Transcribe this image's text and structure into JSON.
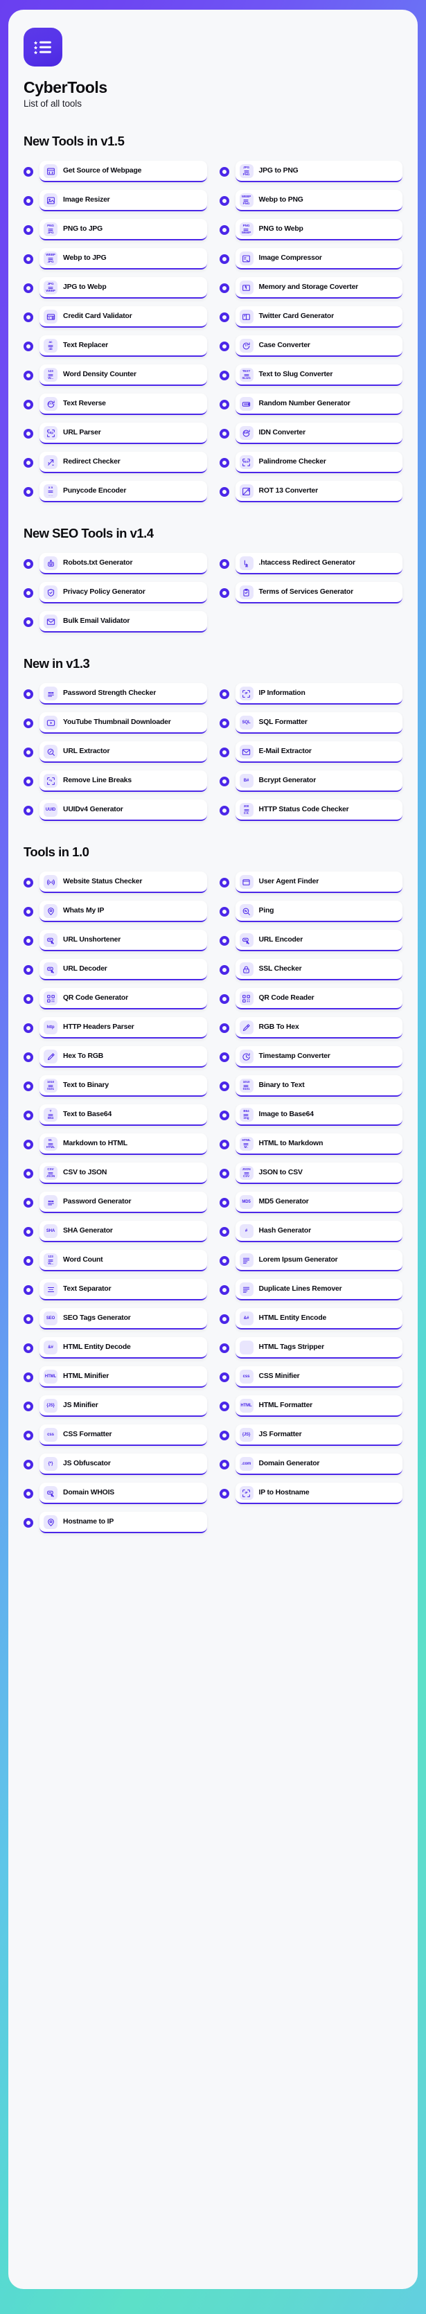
{
  "header": {
    "logo_icon": "bullet-list-star-icon",
    "title": "CyberTools",
    "subtitle": "List of all tools"
  },
  "theme": {
    "accent": "#4b27e8",
    "icon_bg": "#e9e6fd",
    "card_bg": "#ffffff",
    "shell_bg": "#f7f8fa",
    "gradient_from": "#6a3ff0",
    "gradient_to": "#5cd9d6"
  },
  "sections": [
    {
      "title": "New Tools in v1.5",
      "tools": [
        {
          "label": "Get Source of Webpage",
          "icon": "browser-code-icon",
          "glyph": "code"
        },
        {
          "label": "JPG to PNG",
          "icon": "jpg-to-png-icon",
          "glyph": "t2",
          "top": "JPG",
          "bottom": "PNG"
        },
        {
          "label": "Image Resizer",
          "icon": "image-resize-icon",
          "glyph": "image"
        },
        {
          "label": "Webp to PNG",
          "icon": "webp-to-png-icon",
          "glyph": "t2",
          "top": "WEBP",
          "bottom": "PNG"
        },
        {
          "label": "PNG to JPG",
          "icon": "png-to-jpg-icon",
          "glyph": "t2",
          "top": "PNG",
          "bottom": "JPG"
        },
        {
          "label": "PNG to Webp",
          "icon": "png-to-webp-icon",
          "glyph": "t2",
          "top": "PNG",
          "bottom": "WEBP"
        },
        {
          "label": "Webp to JPG",
          "icon": "webp-to-jpg-icon",
          "glyph": "t2",
          "top": "WEBP",
          "bottom": "JPG"
        },
        {
          "label": "Image Compressor",
          "icon": "image-compress-icon",
          "glyph": "compress"
        },
        {
          "label": "JPG to Webp",
          "icon": "jpg-to-webp-icon",
          "glyph": "t2",
          "top": "JPG",
          "bottom": "WEBP"
        },
        {
          "label": "Memory and Storage Coverter",
          "icon": "memory-storage-icon",
          "glyph": "swap"
        },
        {
          "label": "Credit Card Validator",
          "icon": "credit-card-icon",
          "glyph": "card"
        },
        {
          "label": "Twitter Card Generator",
          "icon": "twitter-card-icon",
          "glyph": "twcard"
        },
        {
          "label": "Text Replacer",
          "icon": "text-replace-icon",
          "glyph": "t2",
          "top": "ac",
          "bottom": "ab"
        },
        {
          "label": "Case Converter",
          "icon": "case-convert-icon",
          "glyph": "circle-arrow",
          "mark": "Tᴛ"
        },
        {
          "label": "Word Density Counter",
          "icon": "word-density-icon",
          "glyph": "t2",
          "top": "123",
          "bottom": "W..."
        },
        {
          "label": "Text to Slug Converter",
          "icon": "text-to-slug-icon",
          "glyph": "t2",
          "top": "TEXT",
          "bottom": "SLUG"
        },
        {
          "label": "Text Reverse",
          "icon": "text-reverse-icon",
          "glyph": "circle-arrow",
          "mark": "ZYX"
        },
        {
          "label": "Random Number Generator",
          "icon": "random-number-icon",
          "glyph": "dice"
        },
        {
          "label": "URL Parser",
          "icon": "url-parser-icon",
          "glyph": "scan",
          "mark": "http"
        },
        {
          "label": "IDN Converter",
          "icon": "idn-converter-icon",
          "glyph": "circle-arrow",
          "mark": "IDN"
        },
        {
          "label": "Redirect Checker",
          "icon": "redirect-arrows-icon",
          "glyph": "arrows"
        },
        {
          "label": "Palindrome Checker",
          "icon": "palindrome-icon",
          "glyph": "scan",
          "mark": "TEXT"
        },
        {
          "label": "Punycode Encoder",
          "icon": "punycode-icon",
          "glyph": "t2",
          "top": "x n",
          "bottom": "_ _"
        },
        {
          "label": "ROT 13 Converter",
          "icon": "rot13-icon",
          "glyph": "rot"
        }
      ]
    },
    {
      "title": "New SEO Tools in v1.4",
      "tools": [
        {
          "label": "Robots.txt Generator",
          "icon": "robot-icon",
          "glyph": "robot"
        },
        {
          "label": ".htaccess Redirect Generator",
          "icon": "htaccess-icon",
          "glyph": "htaccess"
        },
        {
          "label": "Privacy Policy Generator",
          "icon": "shield-check-icon",
          "glyph": "shield"
        },
        {
          "label": "Terms of Services Generator",
          "icon": "clipboard-check-icon",
          "glyph": "clipboard"
        },
        {
          "label": "Bulk Email Validator",
          "icon": "email-check-icon",
          "glyph": "envelope"
        }
      ]
    },
    {
      "title": "New in v1.3",
      "tools": [
        {
          "label": "Password Strength Checker",
          "icon": "password-dots-icon",
          "glyph": "dots"
        },
        {
          "label": "IP Information",
          "icon": "ip-brackets-icon",
          "glyph": "scan",
          "mark": "IP"
        },
        {
          "label": "YouTube Thumbnail Downloader",
          "icon": "youtube-play-icon",
          "glyph": "play"
        },
        {
          "label": "SQL Formatter",
          "icon": "sql-icon",
          "glyph": "text",
          "mark": "SQL"
        },
        {
          "label": "URL Extractor",
          "icon": "url-extract-icon",
          "glyph": "magnifier"
        },
        {
          "label": "E-Mail Extractor",
          "icon": "email-extract-icon",
          "glyph": "envelope"
        },
        {
          "label": "Remove Line Breaks",
          "icon": "remove-breaks-icon",
          "glyph": "scan",
          "mark": "=x"
        },
        {
          "label": "Bcrypt Generator",
          "icon": "bcrypt-icon",
          "glyph": "text",
          "mark": "B#"
        },
        {
          "label": "UUIDv4 Generator",
          "icon": "uuid-icon",
          "glyph": "text",
          "mark": "UUID"
        },
        {
          "label": "HTTP Status Code Checker",
          "icon": "http-status-icon",
          "glyph": "t2",
          "top": "200",
          "bottom": "0 K"
        }
      ]
    },
    {
      "title": "Tools in 1.0",
      "tools": [
        {
          "label": "Website Status Checker",
          "icon": "signal-icon",
          "glyph": "signal"
        },
        {
          "label": "User Agent Finder",
          "icon": "window-icon",
          "glyph": "window"
        },
        {
          "label": "Whats My IP",
          "icon": "map-pin-icon",
          "glyph": "pin"
        },
        {
          "label": "Ping",
          "icon": "ping-icon",
          "glyph": "ping"
        },
        {
          "label": "URL Unshortener",
          "icon": "url-click-icon",
          "glyph": "urlclick"
        },
        {
          "label": "URL Encoder",
          "icon": "url-click-icon",
          "glyph": "urlclick"
        },
        {
          "label": "URL Decoder",
          "icon": "url-click-icon",
          "glyph": "urlclick"
        },
        {
          "label": "SSL Checker",
          "icon": "lock-icon",
          "glyph": "lock"
        },
        {
          "label": "QR Code Generator",
          "icon": "qr-code-icon",
          "glyph": "qr"
        },
        {
          "label": "QR Code Reader",
          "icon": "qr-code-icon",
          "glyph": "qr"
        },
        {
          "label": "HTTP Headers Parser",
          "icon": "http-doc-icon",
          "glyph": "text",
          "mark": "http"
        },
        {
          "label": "RGB To Hex",
          "icon": "eyedropper-icon",
          "glyph": "pen"
        },
        {
          "label": "Hex To RGB",
          "icon": "eyedropper-icon",
          "glyph": "pen"
        },
        {
          "label": "Timestamp Converter",
          "icon": "clock-icon",
          "glyph": "clock"
        },
        {
          "label": "Text to Binary",
          "icon": "binary-icon",
          "glyph": "t2",
          "top": "1010",
          "bottom": "0101"
        },
        {
          "label": "Binary to Text",
          "icon": "binary-icon",
          "glyph": "t2",
          "top": "1010",
          "bottom": "0101"
        },
        {
          "label": "Text to Base64",
          "icon": "text-base64-icon",
          "glyph": "t2",
          "top": "T",
          "bottom": "B64"
        },
        {
          "label": "Image to Base64",
          "icon": "image-base64-icon",
          "glyph": "t2",
          "top": "B64",
          "bottom": "img"
        },
        {
          "label": "Markdown to HTML",
          "icon": "md-to-html-icon",
          "glyph": "t2",
          "top": "M↓",
          "bottom": "HTML"
        },
        {
          "label": "HTML to Markdown",
          "icon": "html-to-md-icon",
          "glyph": "t2",
          "top": "HTML",
          "bottom": "M↓"
        },
        {
          "label": "CSV to JSON",
          "icon": "csv-to-json-icon",
          "glyph": "t2",
          "top": "CSV",
          "bottom": "JSON"
        },
        {
          "label": "JSON to CSV",
          "icon": "json-to-csv-icon",
          "glyph": "t2",
          "top": "JSON",
          "bottom": "CSV"
        },
        {
          "label": "Password Generator",
          "icon": "password-dots-icon",
          "glyph": "dots"
        },
        {
          "label": "MD5 Generator",
          "icon": "md5-icon",
          "glyph": "text",
          "mark": "MD5"
        },
        {
          "label": "SHA Generator",
          "icon": "sha-icon",
          "glyph": "text",
          "mark": "SHA"
        },
        {
          "label": "Hash Generator",
          "icon": "hash-icon",
          "glyph": "text",
          "mark": "#"
        },
        {
          "label": "Word Count",
          "icon": "word-count-icon",
          "glyph": "t2",
          "top": "123",
          "bottom": "W..."
        },
        {
          "label": "Lorem Ipsum Generator",
          "icon": "lorem-icon",
          "glyph": "lines"
        },
        {
          "label": "Text Separator",
          "icon": "text-separator-icon",
          "glyph": "separator"
        },
        {
          "label": "Duplicate Lines Remover",
          "icon": "duplicate-lines-icon",
          "glyph": "lines"
        },
        {
          "label": "SEO Tags Generator",
          "icon": "seo-tag-icon",
          "glyph": "text",
          "mark": "SEO"
        },
        {
          "label": "HTML Entity Encode",
          "icon": "html-entity-icon",
          "glyph": "text",
          "mark": "&#"
        },
        {
          "label": "HTML Entity Decode",
          "icon": "html-entity-icon",
          "glyph": "text",
          "mark": "&#"
        },
        {
          "label": "HTML Tags Stripper",
          "icon": "html-strip-icon",
          "glyph": "text",
          "mark": "</>"
        },
        {
          "label": "HTML Minifier",
          "icon": "html-min-icon",
          "glyph": "text",
          "mark": "HTML"
        },
        {
          "label": "CSS Minifier",
          "icon": "css-min-icon",
          "glyph": "text",
          "mark": "css"
        },
        {
          "label": "JS Minifier",
          "icon": "js-min-icon",
          "glyph": "text",
          "mark": "{JS}"
        },
        {
          "label": "HTML Formatter",
          "icon": "html-fmt-icon",
          "glyph": "text",
          "mark": "HTML"
        },
        {
          "label": "CSS Formatter",
          "icon": "css-fmt-icon",
          "glyph": "text",
          "mark": "css"
        },
        {
          "label": "JS Formatter",
          "icon": "js-fmt-icon",
          "glyph": "text",
          "mark": "{JS}"
        },
        {
          "label": "JS Obfuscator",
          "icon": "js-obfuscate-icon",
          "glyph": "text",
          "mark": "{*}"
        },
        {
          "label": "Domain Generator",
          "icon": "domain-icon",
          "glyph": "text",
          "mark": ".com"
        },
        {
          "label": "Domain WHOIS",
          "icon": "whois-icon",
          "glyph": "urlclick"
        },
        {
          "label": "IP to Hostname",
          "icon": "ip-brackets-icon",
          "glyph": "scan",
          "mark": "IP"
        },
        {
          "label": "Hostname to IP",
          "icon": "map-pin-icon",
          "glyph": "pin"
        }
      ]
    }
  ]
}
